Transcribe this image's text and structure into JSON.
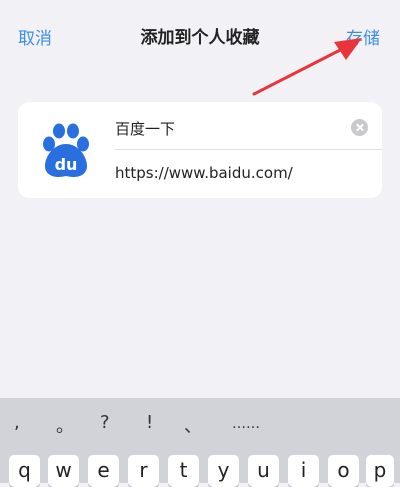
{
  "nav": {
    "cancel_label": "取消",
    "title": "添加到个人收藏",
    "save_label": "存储"
  },
  "bookmark": {
    "name": "百度一下",
    "url": "https://www.baidu.com/",
    "logo_text": "du"
  },
  "keyboard": {
    "symbols": [
      ",",
      "。",
      "?",
      "!",
      "、",
      "……"
    ],
    "letters": [
      "q",
      "w",
      "e",
      "r",
      "t",
      "y",
      "u",
      "i",
      "o",
      "p"
    ]
  },
  "colors": {
    "accent": "#3d8ee6",
    "arrow": "#e8343a",
    "logo_blue": "#2a6fdf"
  }
}
